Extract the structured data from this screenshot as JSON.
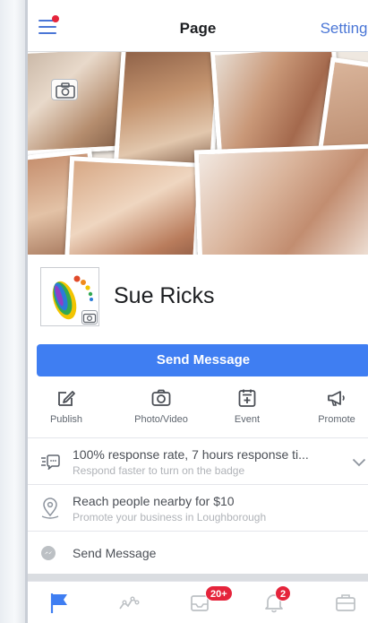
{
  "nav": {
    "title": "Page",
    "settings_label": "Settings"
  },
  "page": {
    "name": "Sue Ricks"
  },
  "primary_action": {
    "label": "Send Message"
  },
  "actions": [
    {
      "label": "Publish",
      "icon": "publish-pencil-icon"
    },
    {
      "label": "Photo/Video",
      "icon": "camera-icon"
    },
    {
      "label": "Event",
      "icon": "event-calendar-icon"
    },
    {
      "label": "Promote",
      "icon": "megaphone-icon"
    }
  ],
  "rows": {
    "response": {
      "title": "100% response rate, 7 hours response ti...",
      "subtitle": "Respond faster to turn on the badge",
      "icon": "response-speed-icon"
    },
    "reach": {
      "title": "Reach people nearby for $10",
      "subtitle": "Promote your business in Loughborough",
      "icon": "location-pin-icon"
    },
    "message": {
      "title": "Send Message",
      "icon": "messenger-icon"
    }
  },
  "tabs": [
    {
      "name": "page",
      "icon": "flag-icon",
      "active": true
    },
    {
      "name": "insights",
      "icon": "insights-line-icon"
    },
    {
      "name": "inbox",
      "icon": "inbox-icon",
      "badge": "20+"
    },
    {
      "name": "notifications",
      "icon": "bell-icon",
      "badge": "2"
    },
    {
      "name": "tools",
      "icon": "briefcase-icon"
    }
  ],
  "colors": {
    "accent": "#3f7ef2",
    "link": "#4a76d6",
    "badge": "#e5243b",
    "muted": "#b0b3b8"
  }
}
